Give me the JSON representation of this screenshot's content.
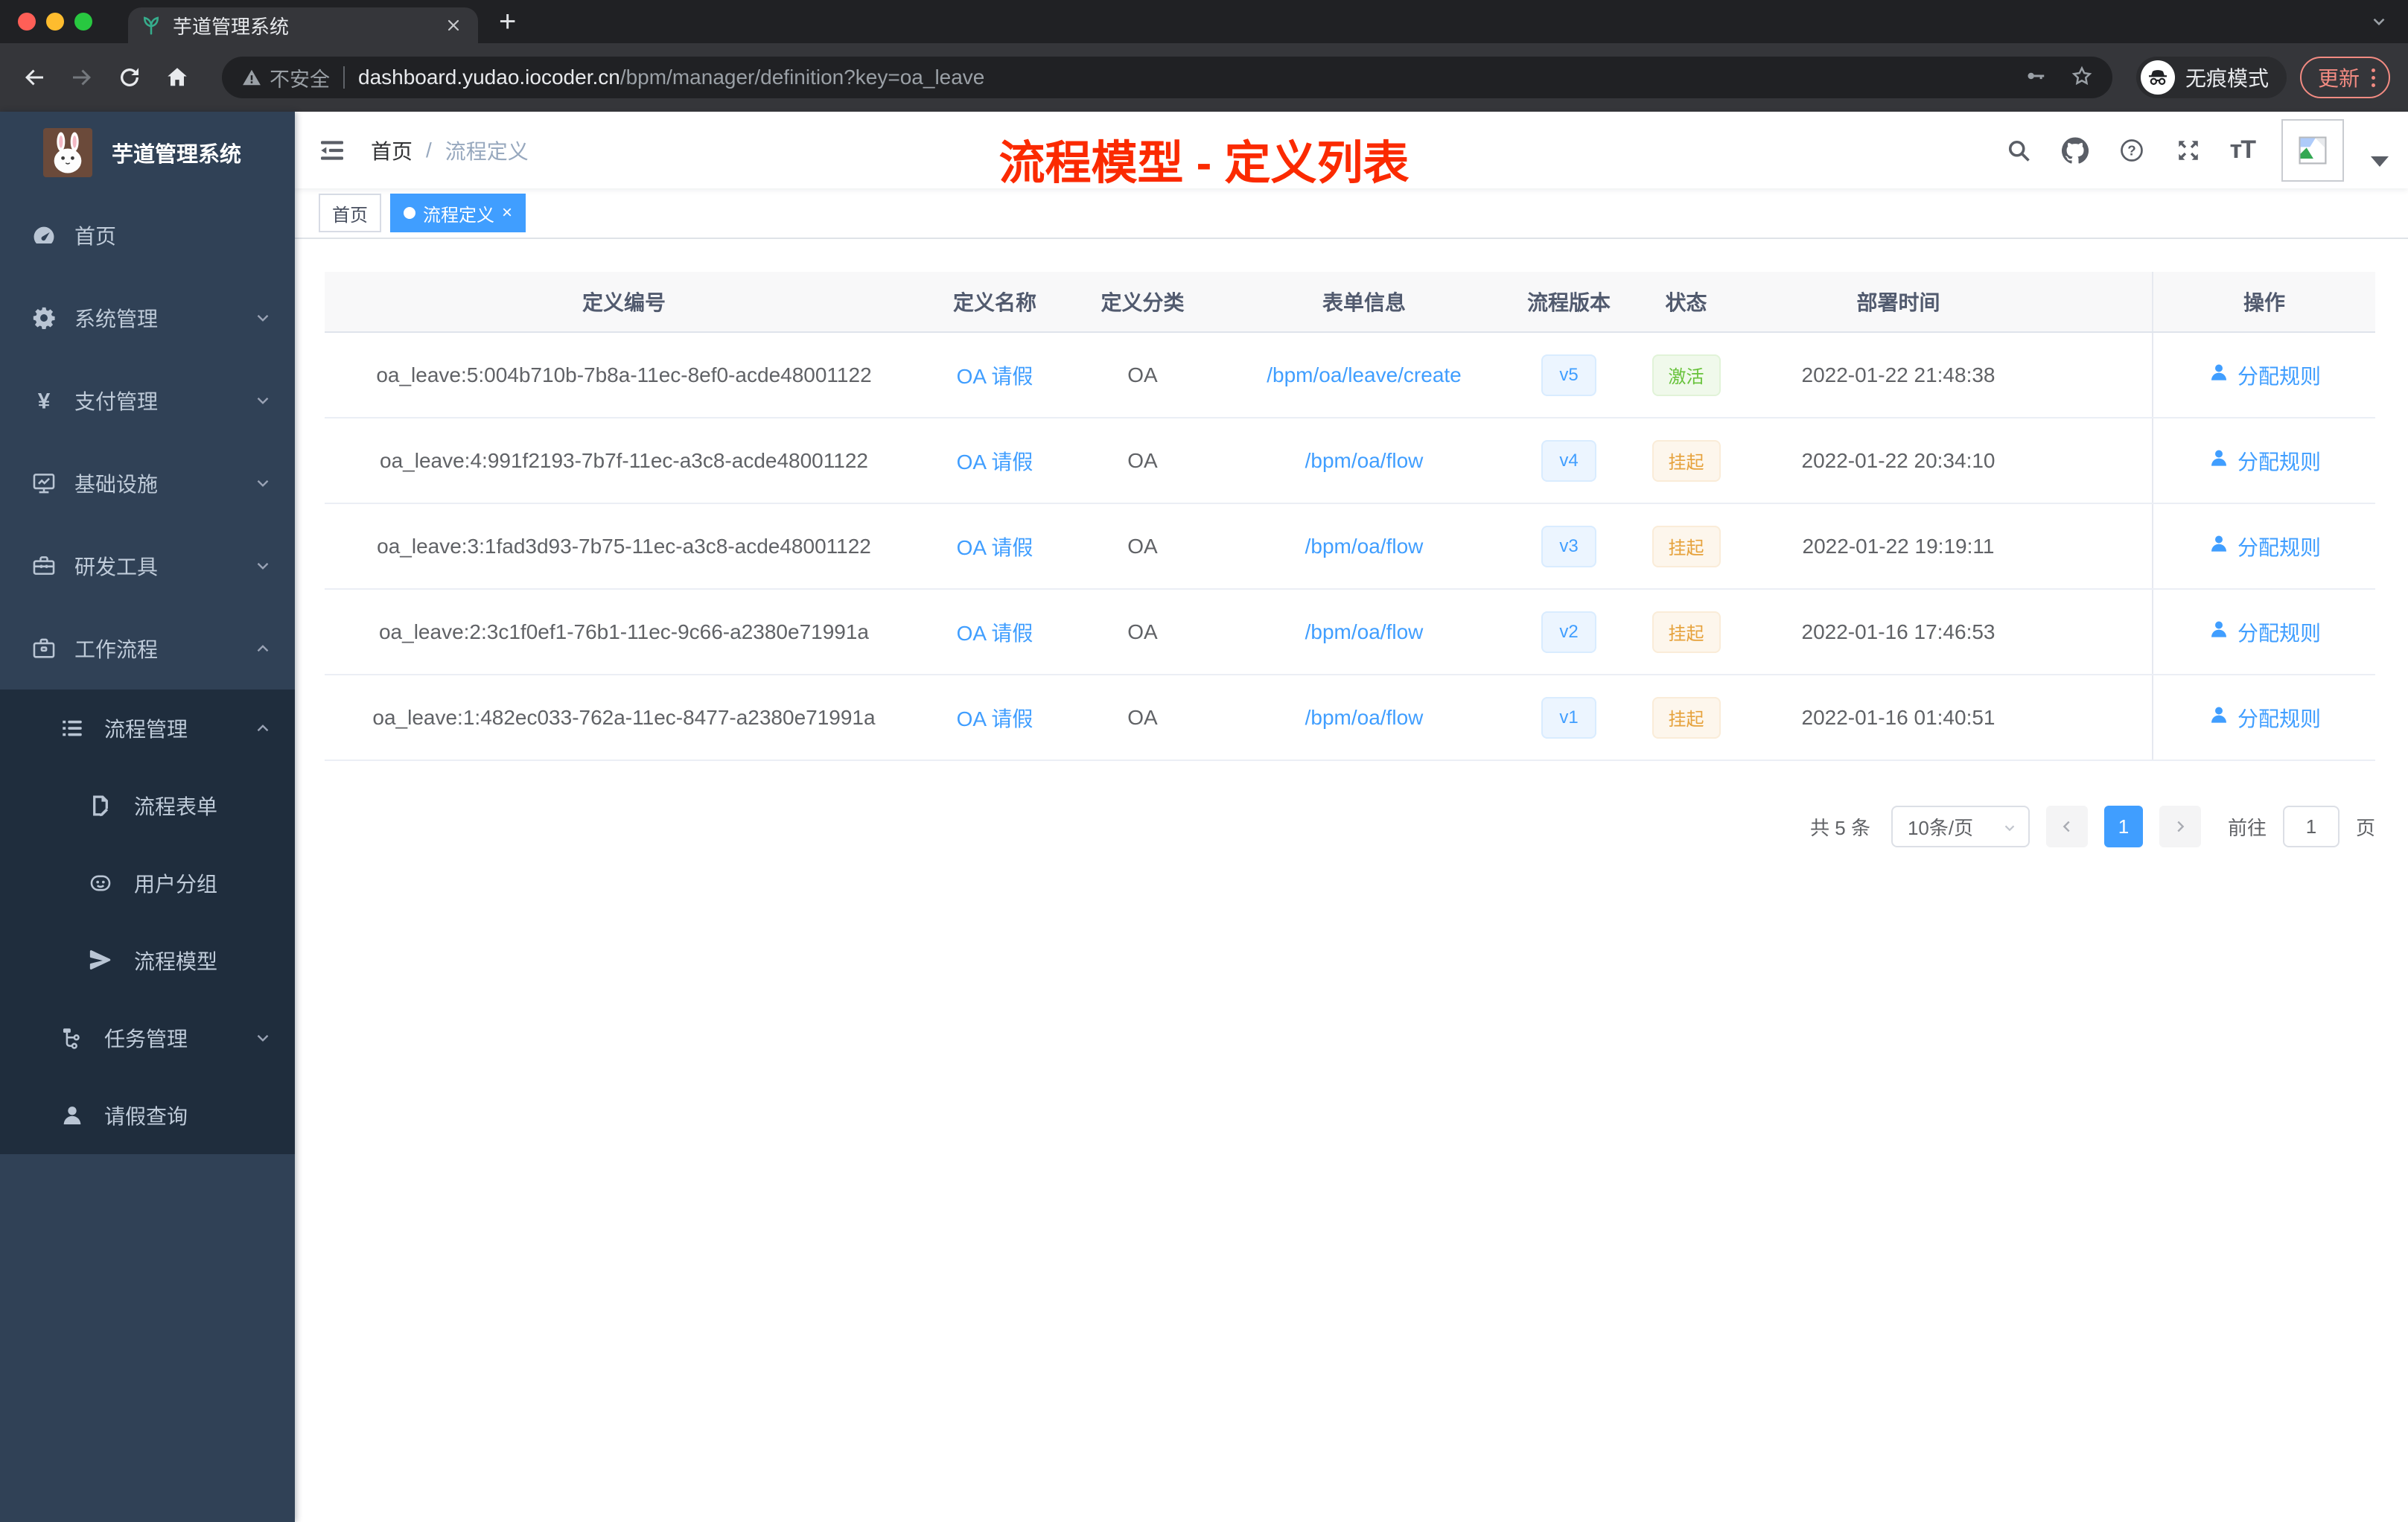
{
  "colors": {
    "accent": "#409eff",
    "success": "#67c23a",
    "warning": "#e6a23c",
    "annotation_red": "#fb2a00",
    "sidebar_bg": "#304156",
    "sidebar_submenu_bg": "#1f2d3d"
  },
  "browser": {
    "tab_title": "芋道管理系统",
    "security_label": "不安全",
    "url_domain": "dashboard.yudao.iocoder.cn",
    "url_path": "/bpm/manager/definition?key=oa_leave",
    "incognito_label": "无痕模式",
    "update_label": "更新"
  },
  "sidebar": {
    "title": "芋道管理系统",
    "menu": [
      {
        "key": "home",
        "label": "首页",
        "icon": "dashboard",
        "level": 1,
        "chevron": null,
        "dark": false
      },
      {
        "key": "system",
        "label": "系统管理",
        "icon": "gear",
        "level": 1,
        "chevron": "down",
        "dark": false
      },
      {
        "key": "payment",
        "label": "支付管理",
        "icon": "yen",
        "level": 1,
        "chevron": "down",
        "dark": false
      },
      {
        "key": "infrastructure",
        "label": "基础设施",
        "icon": "monitor",
        "level": 1,
        "chevron": "down",
        "dark": false
      },
      {
        "key": "dev-tools",
        "label": "研发工具",
        "icon": "toolbox",
        "level": 1,
        "chevron": "down",
        "dark": false
      },
      {
        "key": "workflow",
        "label": "工作流程",
        "icon": "briefcase",
        "level": 1,
        "chevron": "up",
        "dark": false
      },
      {
        "key": "process-manage",
        "label": "流程管理",
        "icon": "list",
        "level": 2,
        "chevron": "up",
        "dark": true
      },
      {
        "key": "process-form",
        "label": "流程表单",
        "icon": "form",
        "level": 3,
        "chevron": null,
        "dark": true
      },
      {
        "key": "user-group",
        "label": "用户分组",
        "icon": "group",
        "level": 3,
        "chevron": null,
        "dark": true
      },
      {
        "key": "process-model",
        "label": "流程模型",
        "icon": "plane",
        "level": 3,
        "chevron": null,
        "dark": true
      },
      {
        "key": "task-manage",
        "label": "任务管理",
        "icon": "tree",
        "level": 2,
        "chevron": "down",
        "dark": true
      },
      {
        "key": "leave-query",
        "label": "请假查询",
        "icon": "person",
        "level": 2,
        "chevron": null,
        "dark": true
      }
    ]
  },
  "header": {
    "breadcrumb": {
      "home": "首页",
      "separator": "/",
      "current": "流程定义"
    },
    "annotation": "流程模型 - 定义列表"
  },
  "tags": [
    {
      "label": "首页",
      "active": false
    },
    {
      "label": "流程定义",
      "active": true
    }
  ],
  "table": {
    "columns": [
      "定义编号",
      "定义名称",
      "定义分类",
      "表单信息",
      "流程版本",
      "状态",
      "部署时间",
      "操作"
    ],
    "rows": [
      {
        "id": "oa_leave:5:004b710b-7b8a-11ec-8ef0-acde48001122",
        "name": "OA 请假",
        "category": "OA",
        "form": "/bpm/oa/leave/create",
        "version": "v5",
        "status": "激活",
        "status_type": "success",
        "time": "2022-01-22 21:48:38",
        "action": "分配规则"
      },
      {
        "id": "oa_leave:4:991f2193-7b7f-11ec-a3c8-acde48001122",
        "name": "OA 请假",
        "category": "OA",
        "form": "/bpm/oa/flow",
        "version": "v4",
        "status": "挂起",
        "status_type": "warning",
        "time": "2022-01-22 20:34:10",
        "action": "分配规则"
      },
      {
        "id": "oa_leave:3:1fad3d93-7b75-11ec-a3c8-acde48001122",
        "name": "OA 请假",
        "category": "OA",
        "form": "/bpm/oa/flow",
        "version": "v3",
        "status": "挂起",
        "status_type": "warning",
        "time": "2022-01-22 19:19:11",
        "action": "分配规则"
      },
      {
        "id": "oa_leave:2:3c1f0ef1-76b1-11ec-9c66-a2380e71991a",
        "name": "OA 请假",
        "category": "OA",
        "form": "/bpm/oa/flow",
        "version": "v2",
        "status": "挂起",
        "status_type": "warning",
        "time": "2022-01-16 17:46:53",
        "action": "分配规则"
      },
      {
        "id": "oa_leave:1:482ec033-762a-11ec-8477-a2380e71991a",
        "name": "OA 请假",
        "category": "OA",
        "form": "/bpm/oa/flow",
        "version": "v1",
        "status": "挂起",
        "status_type": "warning",
        "time": "2022-01-16 01:40:51",
        "action": "分配规则"
      }
    ]
  },
  "pagination": {
    "total_label": "共 5 条",
    "page_size_label": "10条/页",
    "current_page": "1",
    "goto_label": "前往",
    "goto_value": "1",
    "unit_label": "页"
  }
}
